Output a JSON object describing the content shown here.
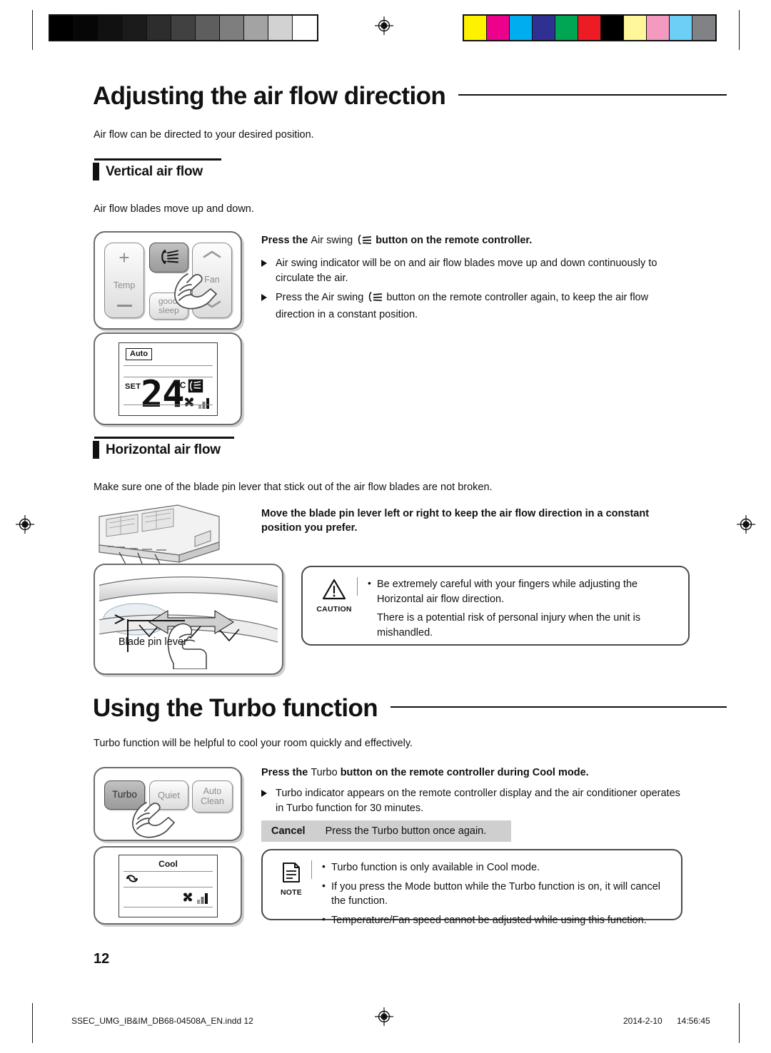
{
  "document": {
    "page_number": "12",
    "footer_file": "SSEC_UMG_IB&IM_DB68-04508A_EN.indd   12",
    "footer_date": "2014-2-10",
    "footer_time": "14:56:45"
  },
  "calibration": {
    "gray_swatches": [
      "#000000",
      "#060606",
      "#111111",
      "#1b1b1b",
      "#2d2d2d",
      "#414141",
      "#5e5e5e",
      "#7e7e7e",
      "#a3a3a3",
      "#d2d2d2",
      "#ffffff"
    ],
    "color_swatches": [
      "#fff200",
      "#ec008c",
      "#00aeef",
      "#2e3192",
      "#00a651",
      "#ed1c24",
      "#000000",
      "#fff79a",
      "#f49ac1",
      "#6dcff6",
      "#808285"
    ]
  },
  "section1": {
    "title": "Adjusting the air flow direction",
    "intro": "Air flow can be directed to your desired position.",
    "vertical": {
      "heading": "Vertical air flow",
      "body": "Air flow blades move up and down.",
      "lead_pre": "Press the",
      "lead_mid": "Air swing",
      "lead_post": "button on the remote controller.",
      "bullets": [
        "Air swing indicator will be on and air flow blades move up and down continuously to circulate the air.",
        "Press the Air swing  button on the remote controller again, to keep the air flow direction in a constant position."
      ],
      "bullet2_pre": "Press the",
      "bullet2_mid": "Air swing",
      "bullet2_post": "button on the remote controller again, to keep the air flow direction in a constant position.",
      "remote": {
        "temp_label": "Temp",
        "plus": "+",
        "minus": "—",
        "fan_label": "Fan",
        "good_sleep": "good’\nsleep",
        "good_line1": "good’",
        "good_line2": "sleep",
        "airswing_icon": "air-swing-icon",
        "up_icon": "chevron-up-icon",
        "down_icon": "chevron-down-icon"
      },
      "display": {
        "mode": "Auto",
        "set_label": "SET",
        "temperature": "24",
        "unit": "°C",
        "swing_icon": "air-swing-indicator-icon",
        "fan_icon": "fan-speed-icon"
      }
    },
    "horizontal": {
      "heading": "Horizontal air flow",
      "body": "Make sure one of the blade pin lever that stick out of the air flow blades are not broken.",
      "lead": "Move the blade pin lever left or right to keep the air flow direction in a constant position you prefer.",
      "blade_label": "Blade pin lever",
      "caution": {
        "label": "CAUTION",
        "items": [
          "Be extremely careful with your fingers while adjusting the Horizontal air flow direction.",
          "There is a potential risk of personal injury when the unit is mishandled."
        ]
      }
    }
  },
  "section2": {
    "title": "Using the Turbo function",
    "intro": "Turbo function will be helpful to cool your room quickly and effectively.",
    "lead_pre": "Press the",
    "lead_mid": "Turbo",
    "lead_post": "button on the remote controller during Cool mode.",
    "bullets": [
      "Turbo indicator appears on the remote controller display and the air conditioner operates in Turbo function for 30 minutes."
    ],
    "remote": {
      "turbo": "Turbo",
      "quiet": "Quiet",
      "auto_clean_line1": "Auto",
      "auto_clean_line2": "Clean"
    },
    "display": {
      "mode": "Cool",
      "turbo_icon": "turbo-indicator-icon",
      "fan_icon": "fan-speed-icon"
    },
    "cancel": {
      "key": "Cancel",
      "text": "Press the Turbo button once again."
    },
    "note": {
      "label": "NOTE",
      "items": [
        "Turbo function is only available in Cool mode.",
        "If you press the Mode button while the Turbo function is on, it will cancel the function.",
        "Temperature/Fan speed cannot be adjusted while using this function."
      ]
    }
  }
}
